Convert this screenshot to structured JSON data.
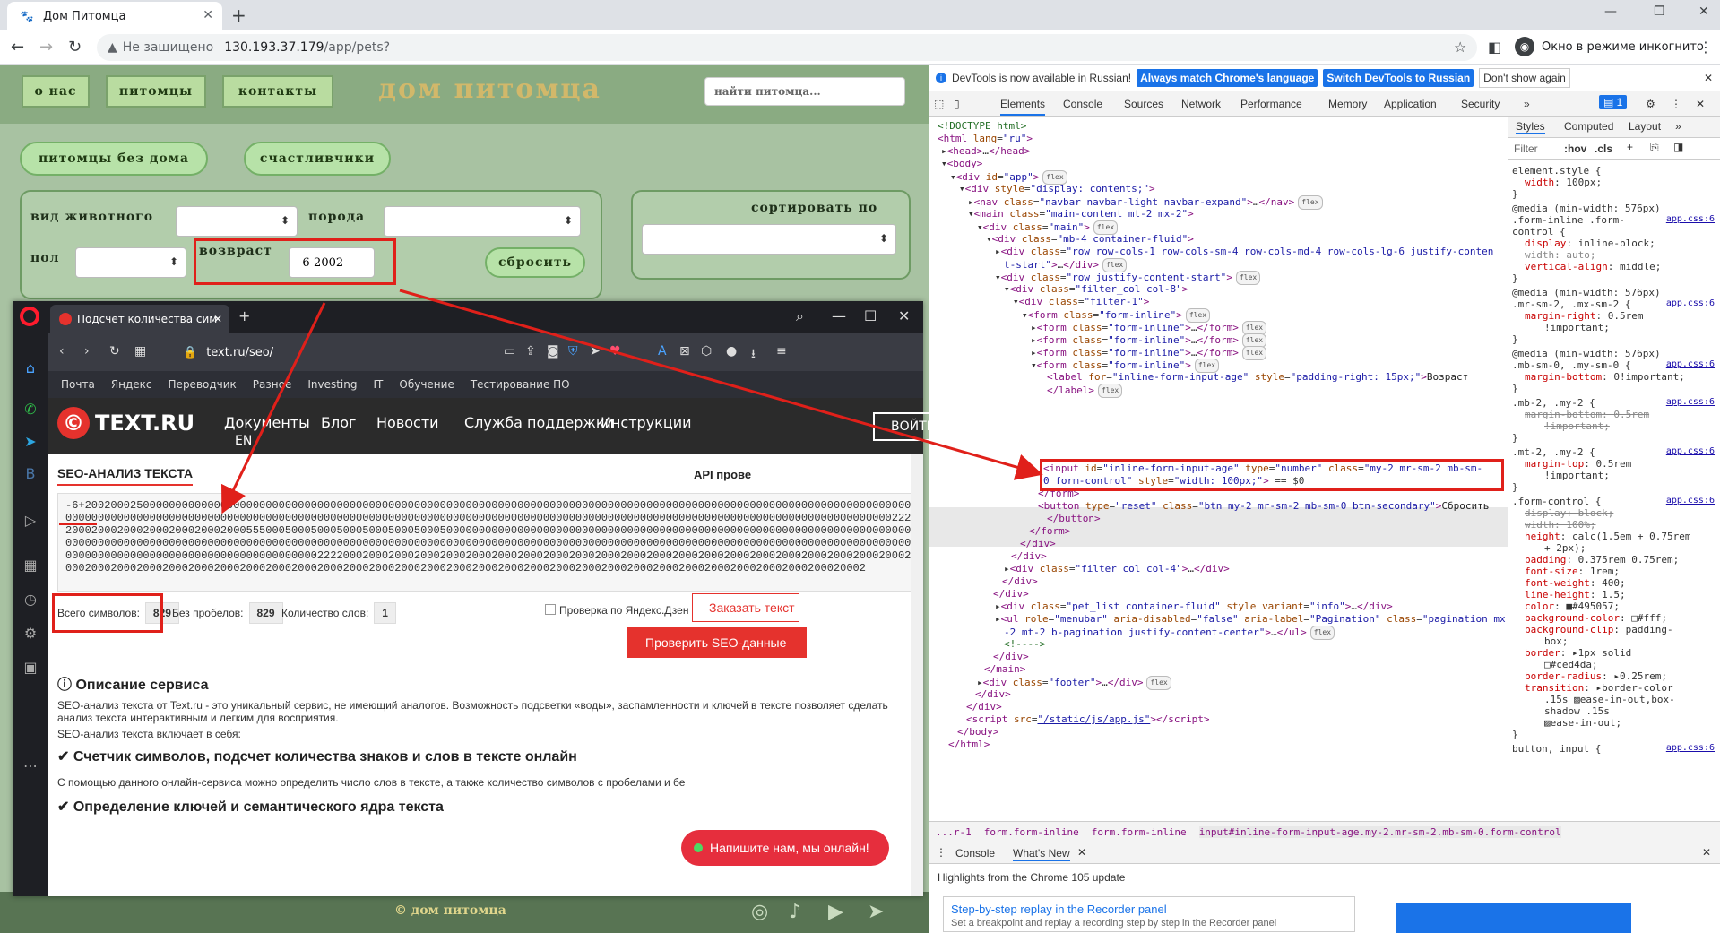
{
  "chrome": {
    "tab_title": "Дом Питомца",
    "not_secure": "Не защищено",
    "url_host": "130.193.37.179",
    "url_path": "/app/pets?",
    "incognito": "Окно в режиме инкогнито"
  },
  "site": {
    "nav": [
      "о нас",
      "питомцы",
      "контакты"
    ],
    "logo": "дом питомца",
    "search_placeholder": "найти питомца...",
    "pills": [
      "питомцы без дома",
      "счастливчики"
    ],
    "filters": {
      "animal": "вид животного",
      "breed": "порода",
      "gender": "пол",
      "age": "возвраст",
      "age_value": "-6-2002",
      "reset": "сбросить",
      "sort": "сортировать по"
    },
    "footer": "© дом питомца"
  },
  "opera": {
    "tab_title": "Подсчет количества сим",
    "url": "text.ru/seo/",
    "bookmarks": [
      "Почта",
      "Яндекс",
      "Переводчик",
      "Разное",
      "Investing",
      "IT",
      "Обучение",
      "Тестирование ПО"
    ],
    "logo": "TEXT.RU",
    "menu": [
      "Документы",
      "Блог",
      "Новости",
      "Служба поддержки",
      "Инструкции"
    ],
    "lang": "EN",
    "login": "ВОЙТИ",
    "section_title": "SEO-АНАЛИЗ ТЕКСТА",
    "api": "API прове",
    "text": "-6+20020002500000000000000000000000000000000000000000000000000000000000000000000000000000000000000000000000000000000000000000000000000000000000000000000000000000000000000000000000000000000000000000000000000000000000000000000000000000000000000000000000000000002222000200020002000200020002000555000500050005000500050005000500000000000000000000000000000000000000000000000000000000000000000000000000000000000000000000000000000000000000000000000000000000000000000000000000000000000000000000000000000000000000000000000000000000000000000000000000000000000000000000000000222200020002000200020002000200020002000200020002000200020002000200020002000200020002000200020002000200020002000200020002000200020002000200020002000200020002000200020002000200020002000200020002000200020002000200020002",
    "stats": {
      "total_label": "Всего символов:",
      "total": "829",
      "nospace_label": "Без пробелов:",
      "nospace": "829",
      "words_label": "Количество слов:",
      "words": "1"
    },
    "dzen": "Проверка по Яндекс.Дзен",
    "order": "Заказать текст",
    "check": "Проверить SEO-данные",
    "desc_title": "Описание сервиса",
    "desc_p1": "SEO-анализ текста от Text.ru - это уникальный сервис, не имеющий аналогов. Возможность подсветки «воды», заспамленности и ключей в тексте позволяет сделать анализ текста интерактивным и легким для восприятия.",
    "desc_p2": "SEO-анализ текста включает в себя:",
    "h_counter": "Счетчик символов, подсчет количества знаков и слов в тексте онлайн",
    "counter_p": "С помощью данного онлайн-сервиса можно определить число слов в тексте, а также количество символов с пробелами и бе",
    "h_keys": "Определение ключей и семантического ядра текста",
    "chat": "Напишите нам, мы онлайн!"
  },
  "devtools": {
    "info": "DevTools is now available in Russian!",
    "btn_match": "Always match Chrome's language",
    "btn_switch": "Switch DevTools to Russian",
    "btn_dont": "Don't show again",
    "tabs": [
      "Elements",
      "Console",
      "Sources",
      "Network",
      "Performance",
      "Memory",
      "Application",
      "Security"
    ],
    "badge": "1",
    "style_tabs": [
      "Styles",
      "Computed",
      "Layout"
    ],
    "filter": "Filter",
    "hov": ":hov",
    "cls": ".cls",
    "crumbs": [
      "...r-1",
      "form.form-inline",
      "form.form-inline",
      "input#inline-form-input-age.my-2.mr-sm-2.mb-sm-0.form-control"
    ],
    "drawer_tabs": [
      "Console",
      "What's New"
    ],
    "highlights": "Highlights from the Chrome 105 update",
    "card_title": "Step-by-step replay in the Recorder panel",
    "card_sub": "Set a breakpoint and replay a recording step by step in the Recorder panel"
  }
}
